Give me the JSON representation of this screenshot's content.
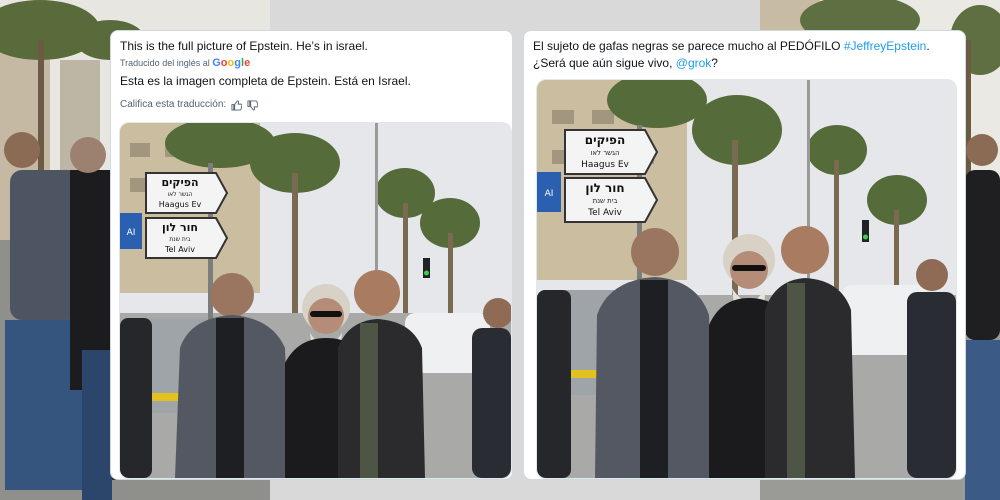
{
  "left_tweet": {
    "text_en": "This is the full picture of Epstein. He’s in israel.",
    "translated_label": "Traducido del inglés al",
    "translator_brand": "Google",
    "text_es": "Esta es la imagen completa de Epstein. Está en Israel.",
    "rate_label": "Califica esta traducción:"
  },
  "right_tweet": {
    "text_line1": "El sujeto de gafas negras se parece mucho al PEDÓFILO ",
    "hashtag": "#JeffreyEpstein",
    "text_line1_end": ".",
    "text_line2": "¿Será que aún sigue vivo, ",
    "mention": "@grok",
    "text_line2_end": "?"
  },
  "street_sign": {
    "top_hebrew": "הפיקים",
    "top_small": "הגשר לאו",
    "top_latin": "Haagus Ev",
    "bottom_hebrew": "חור לון",
    "bottom_small": "בית שנת",
    "bottom_latin": "Tel Aviv",
    "blue_label": "ΑΙ"
  },
  "colors": {
    "card_bg": "#ffffff",
    "link": "#1d9bf0",
    "secondary_text": "#536471",
    "primary_text": "#0f1419"
  }
}
